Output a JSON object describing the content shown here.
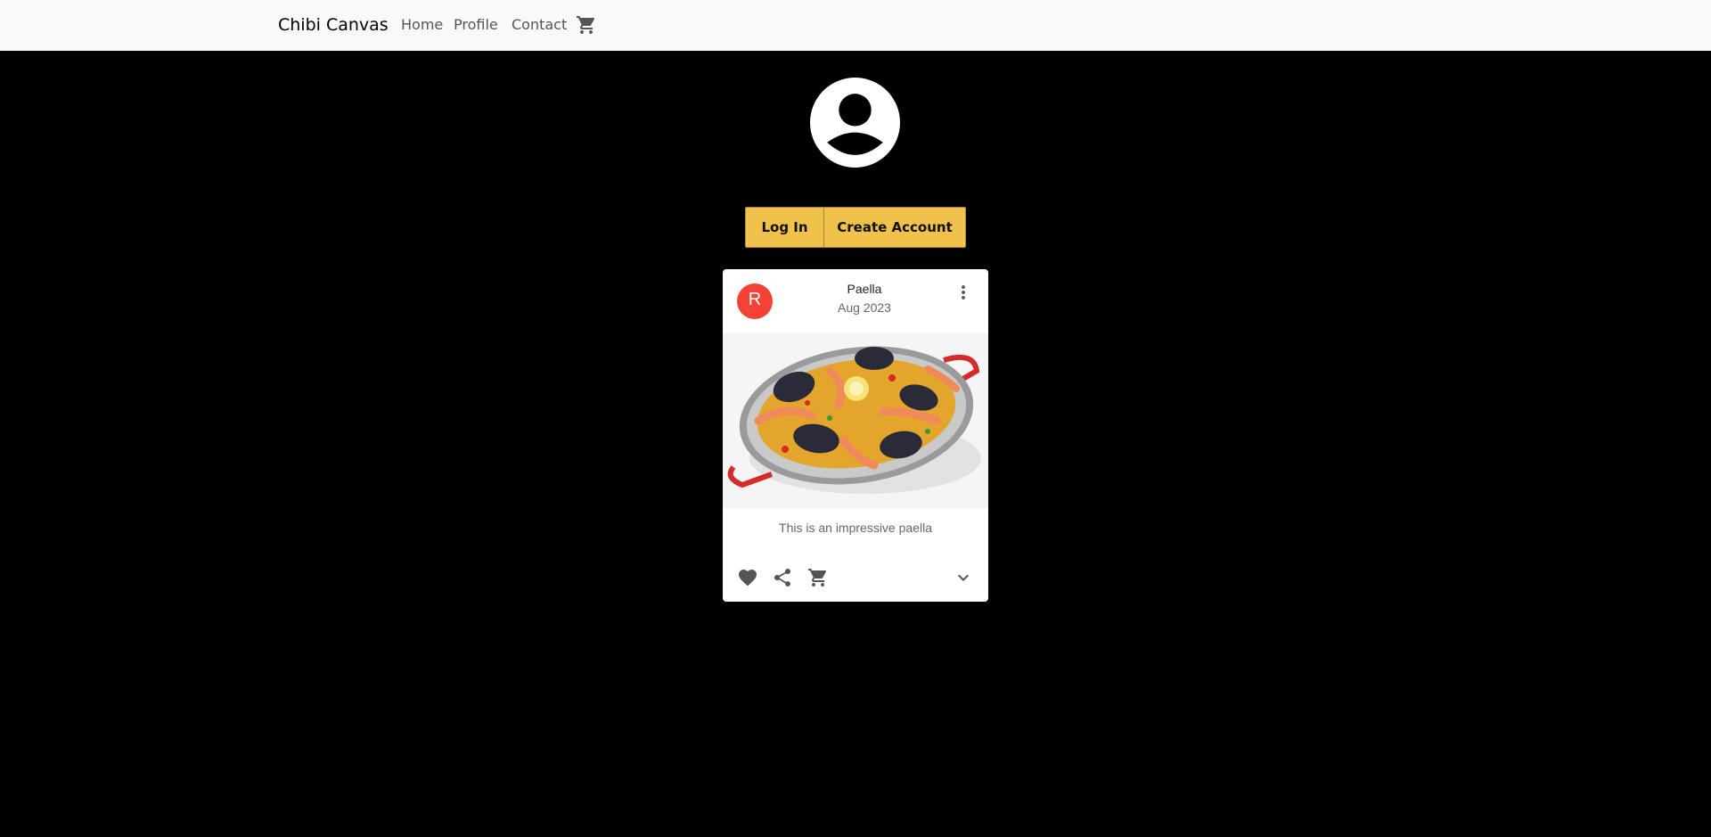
{
  "nav": {
    "brand": "Chibi Canvas",
    "links": [
      "Home",
      "Profile",
      "Contact"
    ],
    "cart_icon": "cart-icon"
  },
  "profile": {
    "avatar_icon": "account-circle-icon"
  },
  "auth": {
    "login_label": "Log In",
    "create_label": "Create Account",
    "button_color": "#f0c14b"
  },
  "card": {
    "avatar_letter": "R",
    "avatar_color": "#f44336",
    "title": "Paella",
    "subheader": "Aug 2023",
    "description": "This is an impressive paella",
    "image_alt": "paella dish",
    "actions": [
      "heart-icon",
      "share-icon",
      "cart-icon",
      "expand-more-icon"
    ],
    "menu_icon": "more-vert-icon"
  }
}
